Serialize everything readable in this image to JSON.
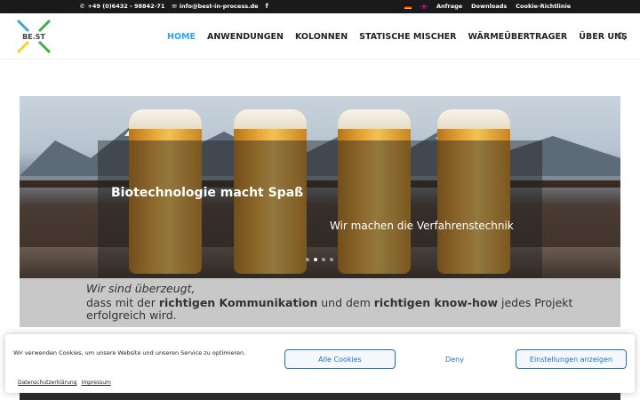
{
  "topbar": {
    "phone": "+49 (0)6432 - 98842-71",
    "email": "info@best-in-process.de",
    "links": [
      "Anfrage",
      "Downloads",
      "Cookie-Richtlinie"
    ]
  },
  "logo": {
    "text": "BE.ST"
  },
  "nav": {
    "items": [
      "HOME",
      "ANWENDUNGEN",
      "KOLONNEN",
      "STATISCHE MISCHER",
      "WÄRMEÜBERTRAGER",
      "ÜBER UNS"
    ],
    "active": "HOME"
  },
  "hero": {
    "title": "Biotechnologie macht Spaß",
    "subtitle": "Wir machen die Verfahrenstechnik"
  },
  "statement": {
    "line1": "Wir sind überzeugt,",
    "part1": "dass mit der ",
    "bold1": "richtigen Kommunikation",
    "part2": " und dem ",
    "bold2": "richtigen know-how",
    "part3": " jedes Projekt erfolgreich wird."
  },
  "cookie": {
    "message": "Wir verwenden Cookies, um unsere Website und unseren Service zu optimieren.",
    "accept_label": "Alle Cookies",
    "deny_label": "Deny",
    "settings_label": "Einstellungen anzeigen",
    "links": [
      "Datenschutzerklärung",
      "Impressum"
    ]
  },
  "colors": {
    "accent": "#2ea3f2",
    "cookie_button": "#1e73be",
    "topbar_bg": "#1a1a1a"
  }
}
